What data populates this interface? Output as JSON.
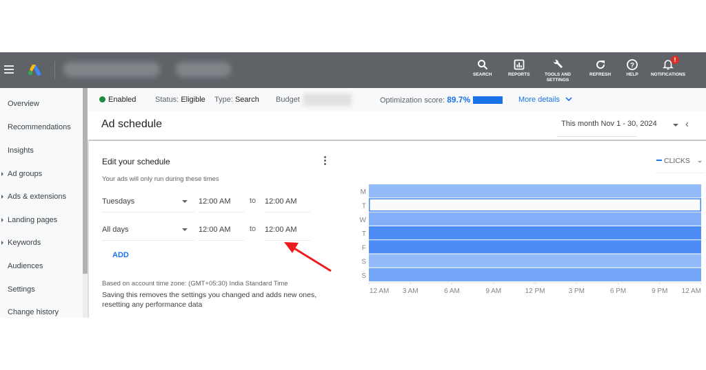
{
  "topbar": {
    "tools": [
      {
        "label": "SEARCH",
        "icon": "search-icon"
      },
      {
        "label": "REPORTS",
        "icon": "reports-icon"
      },
      {
        "label": "TOOLS AND",
        "label2": "SETTINGS",
        "icon": "wrench-icon"
      },
      {
        "label": "REFRESH",
        "icon": "refresh-icon"
      },
      {
        "label": "HELP",
        "icon": "help-icon"
      },
      {
        "label": "NOTIFICATIONS",
        "icon": "bell-icon",
        "badge": "!"
      }
    ]
  },
  "sidebar": {
    "items": [
      {
        "label": "Overview",
        "expandable": false
      },
      {
        "label": "Recommendations",
        "expandable": false
      },
      {
        "label": "Insights",
        "expandable": false
      },
      {
        "label": "Ad groups",
        "expandable": true
      },
      {
        "label": "Ads & extensions",
        "expandable": true
      },
      {
        "label": "Landing pages",
        "expandable": true
      },
      {
        "label": "Keywords",
        "expandable": true
      },
      {
        "label": "Audiences",
        "expandable": false
      },
      {
        "label": "Settings",
        "expandable": false
      },
      {
        "label": "Change history",
        "expandable": false
      }
    ]
  },
  "statusbar": {
    "enabled": "Enabled",
    "status_label": "Status:",
    "status_value": "Eligible",
    "type_label": "Type:",
    "type_value": "Search",
    "budget_label": "Budget",
    "optimization_label": "Optimization score:",
    "optimization_value": "89.7%",
    "optimization_percent": 89.7,
    "more_details": "More details",
    "colors": {
      "enabled": "#1e8e3e",
      "accent": "#1a73e8"
    }
  },
  "header": {
    "title": "Ad schedule",
    "date_range": "This month  Nov 1 - 30, 2024"
  },
  "editor": {
    "title": "Edit your schedule",
    "subtitle": "Your ads will only run during these times",
    "rows": [
      {
        "day": "Tuesdays",
        "from": "12:00 AM",
        "to_label": "to",
        "to": "12:00 AM"
      },
      {
        "day": "All days",
        "from": "12:00 AM",
        "to_label": "to",
        "to": "12:00 AM"
      }
    ],
    "add_label": "ADD",
    "timezone_note": "Based on account time zone: (GMT+05:30) India Standard Time",
    "warning": "Saving this removes the settings you changed and adds new ones, resetting any performance data"
  },
  "chart_data": {
    "type": "heatmap",
    "title": "",
    "metric": "CLICKS",
    "rows": [
      "M",
      "T",
      "W",
      "T",
      "F",
      "S",
      "S"
    ],
    "x_ticks": [
      "12 AM",
      "3 AM",
      "6 AM",
      "9 AM",
      "12 PM",
      "3 PM",
      "6 PM",
      "9 PM",
      "12 AM"
    ],
    "x_range_hours": [
      0,
      24
    ],
    "row_intensity": [
      0.25,
      0,
      0.4,
      0.9,
      0.9,
      0.25,
      0.55
    ],
    "selected_row": 1,
    "colors": {
      "low": "#aecbfa",
      "high": "#4285f4",
      "selected_border": "#4285f4"
    }
  }
}
